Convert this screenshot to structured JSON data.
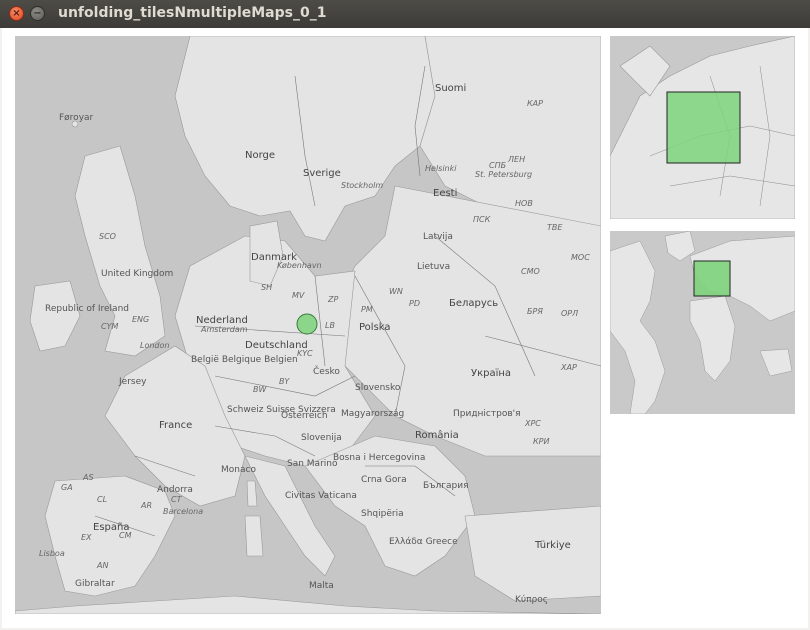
{
  "window": {
    "title": "unfolding_tilesNmultipleMaps_0_1",
    "close_glyph": "×",
    "minimize_glyph": "−"
  },
  "main_map": {
    "labels": [
      {
        "text": "Føroyar",
        "cls": "lbl"
      },
      {
        "text": "Suomi",
        "cls": "lbl lbl-big"
      },
      {
        "text": "КАР",
        "cls": "lbl lbl-it"
      },
      {
        "text": "Norge",
        "cls": "lbl lbl-big"
      },
      {
        "text": "Sverige",
        "cls": "lbl lbl-big"
      },
      {
        "text": "Stockholm",
        "cls": "lbl lbl-it"
      },
      {
        "text": "Helsinki",
        "cls": "lbl lbl-it"
      },
      {
        "text": "ЛЕН",
        "cls": "lbl lbl-it"
      },
      {
        "text": "St. Petersburg",
        "cls": "lbl lbl-it"
      },
      {
        "text": "СПБ",
        "cls": "lbl lbl-it"
      },
      {
        "text": "Eesti",
        "cls": "lbl lbl-big"
      },
      {
        "text": "НОВ",
        "cls": "lbl lbl-it"
      },
      {
        "text": "ПСК",
        "cls": "lbl lbl-it"
      },
      {
        "text": "ТВЕ",
        "cls": "lbl lbl-it"
      },
      {
        "text": "SCO",
        "cls": "lbl lbl-it"
      },
      {
        "text": "United Kingdom",
        "cls": "lbl"
      },
      {
        "text": "Danmark",
        "cls": "lbl lbl-big"
      },
      {
        "text": "København",
        "cls": "lbl lbl-it"
      },
      {
        "text": "Latvija",
        "cls": "lbl"
      },
      {
        "text": "Lietuva",
        "cls": "lbl"
      },
      {
        "text": "СМО",
        "cls": "lbl lbl-it"
      },
      {
        "text": "МОС",
        "cls": "lbl lbl-it"
      },
      {
        "text": "Republic of Ireland",
        "cls": "lbl"
      },
      {
        "text": "CYM",
        "cls": "lbl lbl-it"
      },
      {
        "text": "ENG",
        "cls": "lbl lbl-it"
      },
      {
        "text": "London",
        "cls": "lbl lbl-it"
      },
      {
        "text": "Nederland",
        "cls": "lbl lbl-big"
      },
      {
        "text": "Amsterdam",
        "cls": "lbl lbl-it"
      },
      {
        "text": "SH",
        "cls": "lbl lbl-it"
      },
      {
        "text": "MV",
        "cls": "lbl lbl-it"
      },
      {
        "text": "ZP",
        "cls": "lbl lbl-it"
      },
      {
        "text": "PM",
        "cls": "lbl lbl-it"
      },
      {
        "text": "WN",
        "cls": "lbl lbl-it"
      },
      {
        "text": "PD",
        "cls": "lbl lbl-it"
      },
      {
        "text": "Беларусь",
        "cls": "lbl lbl-big"
      },
      {
        "text": "БРЯ",
        "cls": "lbl lbl-it"
      },
      {
        "text": "ОРЛ",
        "cls": "lbl lbl-it"
      },
      {
        "text": "Polska",
        "cls": "lbl lbl-big"
      },
      {
        "text": "België Belgique Belgien",
        "cls": "lbl"
      },
      {
        "text": "Deutschland",
        "cls": "lbl lbl-big"
      },
      {
        "text": "KYC",
        "cls": "lbl lbl-it"
      },
      {
        "text": "LB",
        "cls": "lbl lbl-it"
      },
      {
        "text": "Jersey",
        "cls": "lbl"
      },
      {
        "text": "BY",
        "cls": "lbl lbl-it"
      },
      {
        "text": "BW",
        "cls": "lbl lbl-it"
      },
      {
        "text": "Česko",
        "cls": "lbl"
      },
      {
        "text": "Slovensko",
        "cls": "lbl"
      },
      {
        "text": "Україна",
        "cls": "lbl lbl-big"
      },
      {
        "text": "ХАР",
        "cls": "lbl lbl-it"
      },
      {
        "text": "France",
        "cls": "lbl lbl-big"
      },
      {
        "text": "Schweiz Suisse Svizzera",
        "cls": "lbl"
      },
      {
        "text": "Österreich",
        "cls": "lbl"
      },
      {
        "text": "Magyarország",
        "cls": "lbl"
      },
      {
        "text": "Придністров'я",
        "cls": "lbl"
      },
      {
        "text": "ХРС",
        "cls": "lbl lbl-it"
      },
      {
        "text": "КРИ",
        "cls": "lbl lbl-it"
      },
      {
        "text": "Slovenija",
        "cls": "lbl"
      },
      {
        "text": "România",
        "cls": "lbl lbl-big"
      },
      {
        "text": "Monaco",
        "cls": "lbl"
      },
      {
        "text": "San Marino",
        "cls": "lbl"
      },
      {
        "text": "Bosna i Hercegovina",
        "cls": "lbl"
      },
      {
        "text": "Crna Gora",
        "cls": "lbl"
      },
      {
        "text": "България",
        "cls": "lbl"
      },
      {
        "text": "GA",
        "cls": "lbl lbl-it"
      },
      {
        "text": "AS",
        "cls": "lbl lbl-it"
      },
      {
        "text": "Andorra",
        "cls": "lbl"
      },
      {
        "text": "CL",
        "cls": "lbl lbl-it"
      },
      {
        "text": "AR",
        "cls": "lbl lbl-it"
      },
      {
        "text": "CT",
        "cls": "lbl lbl-it"
      },
      {
        "text": "Barcelona",
        "cls": "lbl lbl-it"
      },
      {
        "text": "Civitas Vaticana",
        "cls": "lbl"
      },
      {
        "text": "Shqipëria",
        "cls": "lbl"
      },
      {
        "text": "España",
        "cls": "lbl lbl-big"
      },
      {
        "text": "EX",
        "cls": "lbl lbl-it"
      },
      {
        "text": "CM",
        "cls": "lbl lbl-it"
      },
      {
        "text": "Lisboa",
        "cls": "lbl lbl-it"
      },
      {
        "text": "AN",
        "cls": "lbl lbl-it"
      },
      {
        "text": "Ελλάδα Greece",
        "cls": "lbl"
      },
      {
        "text": "Türkiye",
        "cls": "lbl lbl-big"
      },
      {
        "text": "Gibraltar",
        "cls": "lbl"
      },
      {
        "text": "Malta",
        "cls": "lbl"
      },
      {
        "text": "Κύπρος",
        "cls": "lbl"
      }
    ],
    "marker": {
      "color": "#7dd37d",
      "stroke": "#3a7a3a"
    }
  },
  "overview_1": {
    "highlight_color": "#7dd37d"
  },
  "overview_2": {
    "highlight_color": "#7dd37d"
  }
}
